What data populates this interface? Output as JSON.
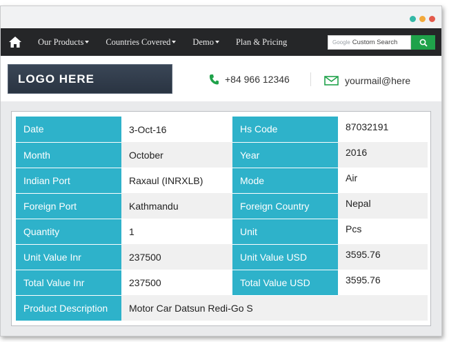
{
  "window": {
    "dot_colors": [
      "#33b8a6",
      "#f2a93b",
      "#e35a4b"
    ]
  },
  "nav": {
    "items": [
      {
        "label": "Our Products",
        "dropdown": true
      },
      {
        "label": "Countries Covered",
        "dropdown": true
      },
      {
        "label": "Demo",
        "dropdown": true
      },
      {
        "label": "Plan & Pricing",
        "dropdown": false
      }
    ],
    "search": {
      "brand": "Google",
      "placeholder": "Custom Search"
    }
  },
  "header": {
    "logo": "LOGO HERE",
    "phone": "+84 966 12346",
    "email": "yourmail@here"
  },
  "record": {
    "date_label": "Date",
    "date": "3-Oct-16",
    "hs_code_label": "Hs Code",
    "hs_code": "87032191",
    "month_label": "Month",
    "month": "October",
    "year_label": "Year",
    "year": "2016",
    "indian_port_label": "Indian Port",
    "indian_port": "Raxaul (INRXLB)",
    "mode_label": "Mode",
    "mode": "Air",
    "foreign_port_label": "Foreign Port",
    "foreign_port": "Kathmandu",
    "foreign_country_label": "Foreign Country",
    "foreign_country": "Nepal",
    "quantity_label": "Quantity",
    "quantity": "1",
    "unit_label": "Unit",
    "unit": "Pcs",
    "unit_value_inr_label": "Unit Value Inr",
    "unit_value_inr": "237500",
    "unit_value_usd_label": "Unit Value USD",
    "unit_value_usd": "3595.76",
    "total_value_inr_label": "Total Value Inr",
    "total_value_inr": "237500",
    "total_value_usd_label": "Total Value USD",
    "total_value_usd": "3595.76",
    "product_description_label": "Product Description",
    "product_description": "Motor Car Datsun Redi-Go S"
  },
  "colors": {
    "label_bg": "#2eb2ca",
    "navbar": "#252628",
    "search_button": "#1fa24a"
  }
}
